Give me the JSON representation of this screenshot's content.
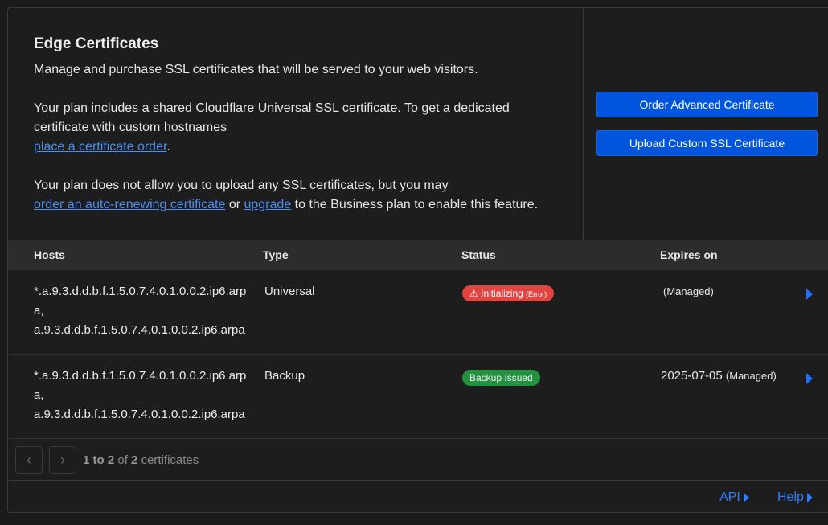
{
  "header": {
    "title": "Edge Certificates",
    "description": "Manage and purchase SSL certificates that will be served to your web visitors.",
    "plan_text": "Your plan includes a shared Cloudflare Universal SSL certificate. To get a dedicated certificate with custom hostnames",
    "plan_link": "place a certificate order",
    "plan_end": ".",
    "upload_text": "Your plan does not allow you to upload any SSL certificates, but you may",
    "upload_link1": "order an auto-renewing certificate",
    "upload_or": "or",
    "upload_link2": "upgrade",
    "upload_end": "to the Business plan to enable this feature."
  },
  "buttons": {
    "order": "Order Advanced Certificate",
    "upload": "Upload Custom SSL Certificate"
  },
  "table": {
    "columns": [
      "Hosts",
      "Type",
      "Status",
      "Expires on"
    ],
    "rows": [
      {
        "host1": "*.a.9.3.d.d.b.f.1.5.0.7.4.0.1.0.0.2.ip6.arpa,",
        "host2": "a.9.3.d.d.b.f.1.5.0.7.4.0.1.0.0.2.ip6.arpa",
        "type": "Universal",
        "status": "Initializing",
        "status_note": "(Error)",
        "expires": "",
        "managed": "(Managed)"
      },
      {
        "host1": "*.a.9.3.d.d.b.f.1.5.0.7.4.0.1.0.0.2.ip6.arpa,",
        "host2": "a.9.3.d.d.b.f.1.5.0.7.4.0.1.0.0.2.ip6.arpa",
        "type": "Backup",
        "status": "Backup Issued",
        "status_note": "",
        "expires": "2025-07-05",
        "managed": "(Managed)"
      }
    ]
  },
  "pager": {
    "range": "1 to 2",
    "of": "of",
    "total": "2",
    "unit": "certificates"
  },
  "footer": {
    "api": "API",
    "help": "Help"
  },
  "colors": {
    "accent": "#0055dc",
    "link": "#4d8ef0",
    "error": "#e14542",
    "success": "#23913f"
  }
}
